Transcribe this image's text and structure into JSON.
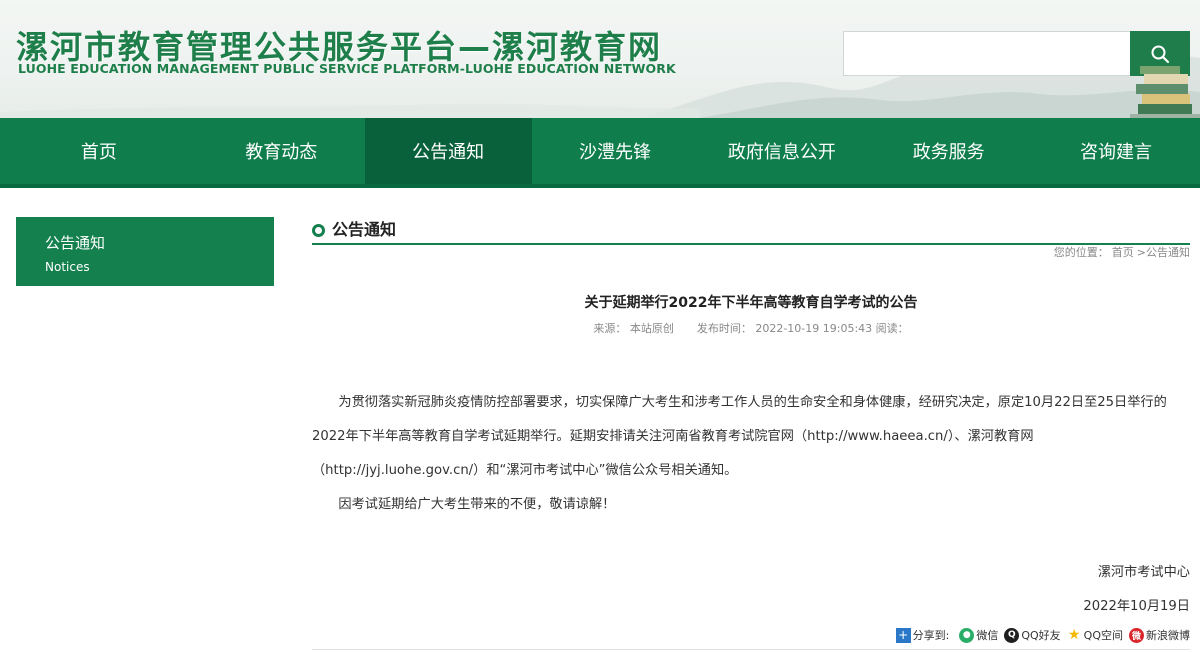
{
  "header": {
    "title": "漯河市教育管理公共服务平台—漯河教育网",
    "subtitle": "LUOHE EDUCATION MANAGEMENT PUBLIC SERVICE PLATFORM-LUOHE EDUCATION NETWORK",
    "search": {
      "placeholder": "",
      "value": ""
    },
    "search_icon": "search-icon",
    "colors": {
      "brand": "#1e7f4a",
      "nav": "#0f7e4c",
      "nav_active": "#08613a"
    }
  },
  "nav": {
    "items": [
      {
        "label": "首页"
      },
      {
        "label": "教育动态"
      },
      {
        "label": "公告通知"
      },
      {
        "label": "沙澧先锋"
      },
      {
        "label": "政府信息公开"
      },
      {
        "label": "政务服务"
      },
      {
        "label": "咨询建言"
      }
    ],
    "active": "公告通知"
  },
  "sidebar": {
    "title": "公告通知",
    "subtitle": "Notices"
  },
  "section": {
    "title": "公告通知",
    "breadcrumb": {
      "prefix": "您的位置：",
      "home": "首页",
      "separator": ">",
      "current": "公告通知"
    }
  },
  "article": {
    "title": "关于延期举行2022年下半年高等教育自学考试的公告",
    "meta": {
      "source_label": "来源：",
      "source": "本站原创",
      "time_label": "发布时间：",
      "time": "2022-10-19 19:05:43",
      "views_label": "阅读："
    },
    "paragraphs": [
      "为贯彻落实新冠肺炎疫情防控部署要求，切实保障广大考生和涉考工作人员的生命安全和身体健康，经研究决定，原定10月22日至25日举行的2022年下半年高等教育自学考试延期举行。延期安排请关注河南省教育考试院官网（http://www.haeea.cn/）、漯河教育网（http://jyj.luohe.gov.cn/）和“漯河市考试中心”微信公众号相关通知。",
      "因考试延期给广大考生带来的不便，敬请谅解！"
    ],
    "signature_org": "漯河市考试中心",
    "signature_date": "2022年10月19日"
  },
  "share": {
    "label": "分享到:",
    "items": [
      {
        "label": "微信",
        "icon": "wechat-icon",
        "color": "#2aae67"
      },
      {
        "label": "QQ好友",
        "icon": "qq-icon",
        "color": "#1f1f1f"
      },
      {
        "label": "QQ空间",
        "icon": "qzone-icon",
        "color": "#f5b800"
      },
      {
        "label": "新浪微博",
        "icon": "weibo-icon",
        "color": "#d9262c"
      }
    ]
  }
}
